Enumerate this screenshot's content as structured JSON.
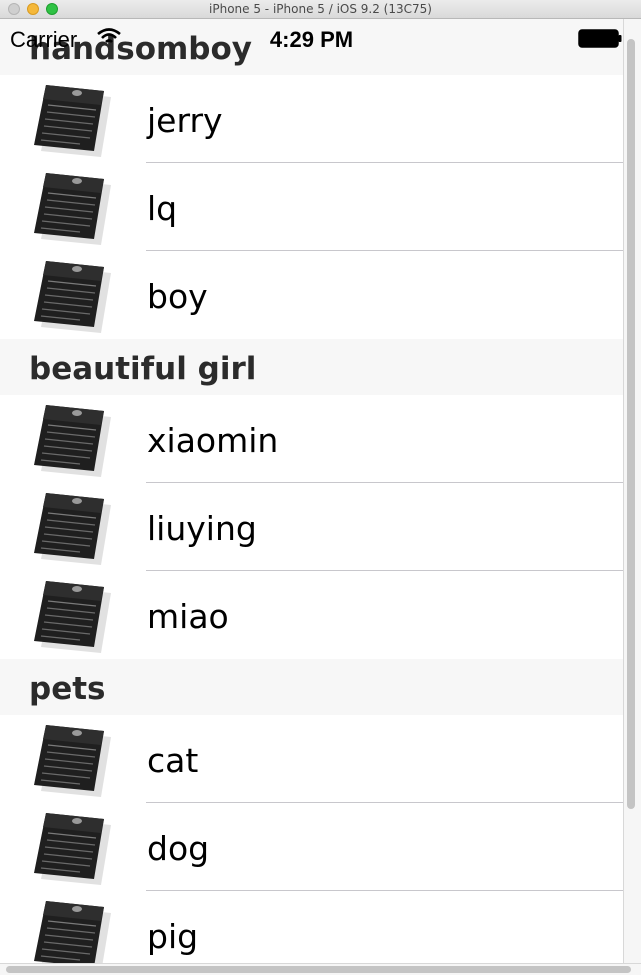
{
  "window": {
    "title": "iPhone 5 - iPhone 5 / iOS 9.2 (13C75)"
  },
  "status_bar": {
    "carrier": "Carrier",
    "time": "4:29 PM"
  },
  "sections": [
    {
      "title": "handsomboy",
      "rows": [
        {
          "label": "jerry",
          "icon": "document-icon"
        },
        {
          "label": "lq",
          "icon": "document-icon"
        },
        {
          "label": "boy",
          "icon": "document-icon"
        }
      ]
    },
    {
      "title": "beautiful girl",
      "rows": [
        {
          "label": "xiaomin",
          "icon": "document-icon"
        },
        {
          "label": "liuying",
          "icon": "document-icon"
        },
        {
          "label": "miao",
          "icon": "document-icon"
        }
      ]
    },
    {
      "title": "pets",
      "rows": [
        {
          "label": "cat",
          "icon": "document-icon"
        },
        {
          "label": "dog",
          "icon": "document-icon"
        },
        {
          "label": "pig",
          "icon": "document-icon"
        }
      ]
    }
  ],
  "colors": {
    "section_header_bg": "#f7f7f7",
    "separator": "#c8c7cc",
    "traffic_close": "#cfcfcf",
    "traffic_minimize": "#f5b83a",
    "traffic_zoom": "#2fc244"
  }
}
